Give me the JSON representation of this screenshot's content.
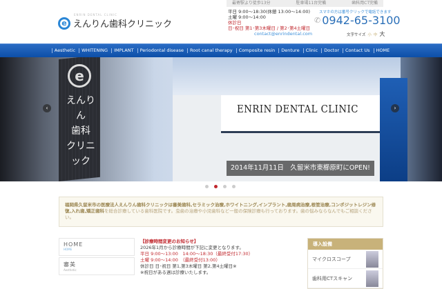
{
  "topbar": [
    "最寄駅より徒歩13分",
    "駐車場11台完備",
    "歯科用CT完備"
  ],
  "logo": {
    "mark": "e",
    "sub": "ENRIN DENTAL CLINIC",
    "name": "えんりん歯科クリニック"
  },
  "hours": {
    "weekday": "平日 9:00〜18:30(休憩 13:00〜14:00)",
    "saturday": "土曜 9:00〜14:00",
    "closed_label": "休診日",
    "closed": "日･祝日 第1･第3木曜日 / 第2･第4土曜日"
  },
  "email": "contact@enrindental.com",
  "phone": {
    "note": "スマホの方は番号クリックで電話できます",
    "number": "0942-65-3100"
  },
  "font_size": {
    "label": "文字サイズ",
    "small": "小",
    "medium": "中",
    "large": "大"
  },
  "nav": [
    "Aesthetic",
    "WHITENING",
    "IMPLANT",
    "Periodontal disease",
    "Root canal therapy",
    "Composite resin",
    "Denture",
    "Clinic",
    "Doctor",
    "Contact Us",
    "HOME"
  ],
  "hero": {
    "tower_text": [
      "えんりん",
      "歯科",
      "クリニック"
    ],
    "sign": "ENRIN DENTAL CLINIC",
    "caption": "2014年11月11日　久留米市東櫛原町にOPEN!",
    "slides": 4,
    "active_slide": 2
  },
  "intro": {
    "p1": "福岡県久留米市の医療法人えんりん歯科クリニックは",
    "kw": "審美歯科,セラミック治療,ホワイトニング,インプラント,歯周病治療,根管治療,コンポジットレジン修復,入れ歯,矯正歯科",
    "p2": "を総合診療している歯科医院です。虫歯の治療や小児歯科など一般の保険診療も行っております。歯の悩みならなんでもご相談ください。"
  },
  "side": [
    {
      "title": "HOME",
      "en": "HOME"
    },
    {
      "title": "審美",
      "en": "Aesthetic"
    }
  ],
  "news": {
    "heading": "【診療時間変更のお知らせ】",
    "line1": "2026年1月から診療時間が下記に変更となります。",
    "weekday": "平日 9:00〜13:00　14:00〜18:30（最終受付17:30）",
    "saturday": "土曜 9:00〜14:00　（最終受付13:00）",
    "closed": "休診日 日･祝日 第1,第3木曜日 第2,第4土曜日※",
    "note": "※祝日がある週は診療いたします。"
  },
  "equip": {
    "heading": "導入設備",
    "items": [
      "マイクロスコープ",
      "歯科用CTスキャン"
    ]
  }
}
